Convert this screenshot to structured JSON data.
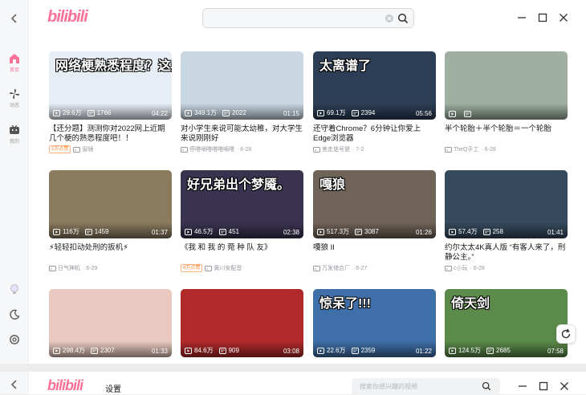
{
  "app": {
    "logo": "bilibili",
    "search": {
      "value": "",
      "placeholder": ""
    }
  },
  "sidebar": {
    "items": [
      {
        "label": "首页",
        "icon": "home-icon",
        "active": true
      },
      {
        "label": "动态",
        "icon": "pinwheel-icon",
        "active": false
      },
      {
        "label": "我的",
        "icon": "tv-icon",
        "active": false
      }
    ]
  },
  "videos": [
    {
      "cap": "网络梗熟悉程度？这是什么梗？",
      "views": "29.6万",
      "danmaku": "1766",
      "duration": "04:22",
      "title": "【还分题】测测你对2022网上近期几个梗的熟悉程度吧！！",
      "badge": "2万点赞",
      "uploader": "窗镜",
      "date": "",
      "bg": "#e6edf5"
    },
    {
      "cap": "",
      "views": "349.1万",
      "danmaku": "2022",
      "duration": "01:15",
      "title": "对小学生来说可能太幼稚，对大学生来说刚刚好",
      "badge": "",
      "uploader": "停嗒嘀嗒嗒嗒嘀嗒",
      "date": "6-28",
      "bg": "#c9d7e3"
    },
    {
      "cap": "太离谱了",
      "views": "69.1万",
      "danmaku": "2394",
      "duration": "05:56",
      "title": "还守着Chrome？6分钟让你爱上Edge浏览器",
      "badge": "",
      "uploader": "差走是号健",
      "date": "7-2",
      "bg": "#2c3e55"
    },
    {
      "cap": "",
      "views": "",
      "danmaku": "",
      "duration": "",
      "title": "半个轮胎＋半个轮胎＝一个轮胎",
      "badge": "",
      "uploader": "TheQ手工",
      "date": "6-28",
      "bg": "#9fb0a2"
    },
    {
      "cap": "",
      "views": "116万",
      "danmaku": "1459",
      "duration": "01:37",
      "title": "⚡轻轻扣动处刑的扳机⚡",
      "badge": "",
      "uploader": "日气神机",
      "date": "6-29",
      "bg": "#8a7a5e"
    },
    {
      "cap": "好兄弟出个梦魇。",
      "views": "46.5万",
      "danmaku": "451",
      "duration": "02:38",
      "title": "《我 和 我 的 菀 种 队 友》",
      "badge": "6万点赞",
      "uploader": "黄川安配音",
      "date": "",
      "bg": "#3a3350"
    },
    {
      "cap": "嘎狼",
      "views": "517.3万",
      "danmaku": "3087",
      "duration": "01:26",
      "title": "嘎狼 II",
      "badge": "",
      "uploader": "万发储合厂",
      "date": "6-27",
      "bg": "#6f6256"
    },
    {
      "cap": "",
      "views": "57.4万",
      "danmaku": "258",
      "duration": "01:41",
      "title": "约尔太太4K真人版 “有客人来了，刑静公主。”",
      "badge": "",
      "uploader": "c小玩",
      "date": "6-28",
      "bg": "#364a5e"
    },
    {
      "cap": "",
      "views": "298.4万",
      "danmaku": "2307",
      "duration": "01:33",
      "title": "",
      "badge": "",
      "uploader": "",
      "date": "",
      "bg": "#e9c9c0"
    },
    {
      "cap": "",
      "views": "84.6万",
      "danmaku": "909",
      "duration": "03:08",
      "title": "",
      "badge": "",
      "uploader": "",
      "date": "",
      "bg": "#b02a2a"
    },
    {
      "cap": "惊呆了!!!",
      "views": "22.6万",
      "danmaku": "2359",
      "duration": "01:22",
      "title": "",
      "badge": "",
      "uploader": "",
      "date": "",
      "bg": "#3f6fa8"
    },
    {
      "cap": "倚天剑",
      "views": "124.5万",
      "danmaku": "2685",
      "duration": "07:58",
      "title": "",
      "badge": "",
      "uploader": "",
      "date": "",
      "bg": "#5b8a4a"
    }
  ],
  "bottom_window": {
    "logo": "bilibili",
    "settings_label": "设置",
    "search_placeholder": "搜索你感兴趣的视频"
  },
  "colors": {
    "accent": "#fb7299",
    "text": "#18191c",
    "meta": "#9499a0"
  }
}
